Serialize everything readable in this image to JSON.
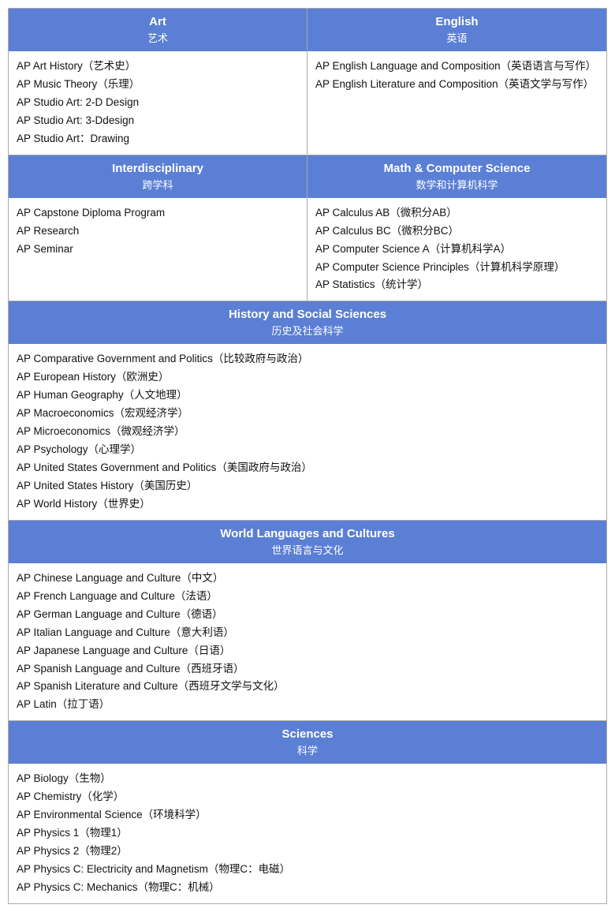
{
  "sections": [
    {
      "type": "two-col",
      "columns": [
        {
          "header_en": "Art",
          "header_zh": "艺术",
          "items": [
            "AP Art History（艺术史）",
            "AP Music Theory（乐理）",
            "AP Studio Art: 2-D Design",
            "AP Studio Art: 3-Ddesign",
            "AP Studio Art：Drawing"
          ]
        },
        {
          "header_en": "English",
          "header_zh": "英语",
          "items": [
            "AP English Language and Composition（英语语言与写作）",
            "AP English Literature and Composition（英语文学与写作）"
          ]
        }
      ]
    },
    {
      "type": "two-col",
      "columns": [
        {
          "header_en": "Interdisciplinary",
          "header_zh": "跨学科",
          "items": [
            "AP Capstone Diploma Program",
            "AP Research",
            "AP Seminar"
          ]
        },
        {
          "header_en": "Math & Computer Science",
          "header_zh": "数学和计算机科学",
          "items": [
            "AP Calculus AB（微积分AB）",
            "AP Calculus BC（微积分BC）",
            "AP Computer Science A（计算机科学A）",
            "AP Computer Science Principles（计算机科学原理）",
            "AP Statistics（统计学）"
          ]
        }
      ]
    },
    {
      "type": "one-col",
      "header_en": "History and Social Sciences",
      "header_zh": "历史及社会科学",
      "items": [
        "AP Comparative Government and Politics（比较政府与政治）",
        "AP European History（欧洲史）",
        "AP Human Geography（人文地理）",
        "AP Macroeconomics（宏观经济学）",
        "AP Microeconomics（微观经济学）",
        "AP Psychology（心理学）",
        "AP United States Government and Politics（美国政府与政治）",
        "AP United States History（美国历史）",
        "AP World History（世界史）"
      ]
    },
    {
      "type": "one-col",
      "header_en": "World Languages and Cultures",
      "header_zh": "世界语言与文化",
      "items": [
        "AP Chinese Language and Culture（中文）",
        "AP French Language and Culture（法语）",
        "AP German Language and Culture（德语）",
        "AP Italian Language and Culture（意大利语）",
        "AP Japanese Language and Culture（日语）",
        "AP Spanish Language and Culture（西班牙语）",
        "AP Spanish Literature and Culture（西班牙文学与文化）",
        "AP Latin（拉丁语）"
      ]
    },
    {
      "type": "one-col",
      "header_en": "Sciences",
      "header_zh": "科学",
      "items": [
        "AP Biology（生物）",
        "AP Chemistry（化学）",
        "AP Environmental Science（环境科学）",
        "AP Physics 1（物理1）",
        "AP Physics 2（物理2）",
        "AP Physics C: Electricity and Magnetism（物理C：电磁）",
        "AP Physics C: Mechanics（物理C：机械）"
      ]
    }
  ]
}
